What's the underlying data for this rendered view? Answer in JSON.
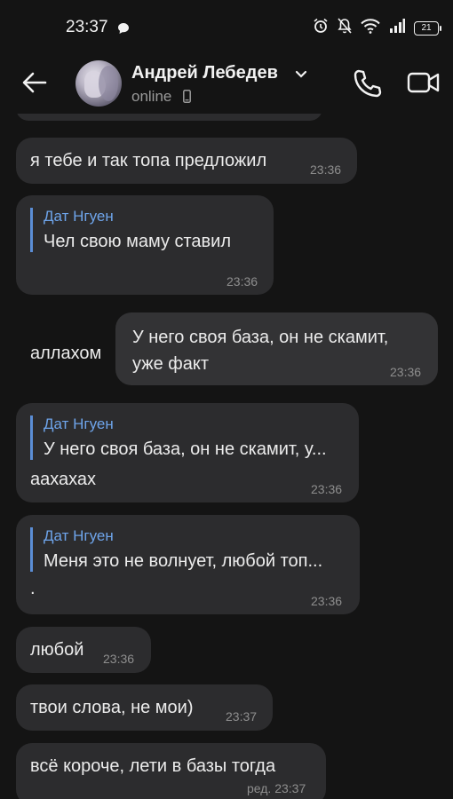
{
  "status_bar": {
    "time": "23:37",
    "battery": "21",
    "icons": [
      "message-icon",
      "alarm-icon",
      "mute-icon",
      "wifi-icon",
      "signal-icon",
      "battery-icon"
    ]
  },
  "header": {
    "contact_name": "Андрей Лебедев",
    "status": "online"
  },
  "messages": [
    {
      "text": "я тебе и так топа предложил",
      "time": "23:36",
      "direction": "in"
    },
    {
      "reply_author": "Дат Нгуен",
      "text_line1": "Чел свою маму ставил",
      "text_line2": "аллахом",
      "time": "23:36",
      "direction": "in"
    },
    {
      "text_line1": "У него своя база, он не скамит,",
      "text_line2": "уже факт",
      "time": "23:36",
      "direction": "out"
    },
    {
      "reply_author": "Дат Нгуен",
      "reply_text": "У него своя база, он не скамит, у...",
      "text": "аахахах",
      "time": "23:36",
      "direction": "in"
    },
    {
      "reply_author": "Дат Нгуен",
      "reply_text": "Меня это не волнует, любой топ...",
      "text": ".",
      "time": "23:36",
      "direction": "in"
    },
    {
      "text": "любой",
      "time": "23:36",
      "direction": "in"
    },
    {
      "text": "твои слова, не мои)",
      "time": "23:37",
      "direction": "in"
    },
    {
      "text": "всё короче, лети в базы тогда",
      "time": "ред. 23:37",
      "direction": "in"
    }
  ],
  "colors": {
    "background": "#141414",
    "bubble_in": "#2c2c2e",
    "bubble_out": "#333335",
    "reply_accent": "#6ea4ea"
  }
}
